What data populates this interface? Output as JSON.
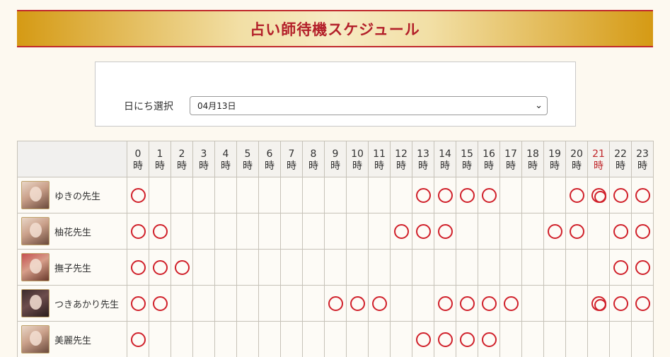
{
  "header": {
    "title": "占い師待機スケジュール"
  },
  "date_selector": {
    "label": "日にち選択",
    "selected": "04月13日"
  },
  "hour_suffix": "時",
  "hours": [
    "0",
    "1",
    "2",
    "3",
    "4",
    "5",
    "6",
    "7",
    "8",
    "9",
    "10",
    "11",
    "12",
    "13",
    "14",
    "15",
    "16",
    "17",
    "18",
    "19",
    "20",
    "21",
    "22",
    "23"
  ],
  "highlight_hour": "21",
  "colors": {
    "accent": "#c0282c",
    "gold": "#d59a14",
    "mark": "#d0202a"
  },
  "legend_marks": {
    "ok": "○",
    "best": "◎"
  },
  "fortune_tellers": [
    {
      "name": "ゆきの先生",
      "avatar": "portrait",
      "slots": [
        "ok",
        "",
        "",
        "",
        "",
        "",
        "",
        "",
        "",
        "",
        "",
        "",
        "",
        "ok",
        "ok",
        "ok",
        "ok",
        "",
        "",
        "",
        "ok",
        "best",
        "ok",
        "ok"
      ]
    },
    {
      "name": "柚花先生",
      "avatar": "portrait",
      "slots": [
        "ok",
        "ok",
        "",
        "",
        "",
        "",
        "",
        "",
        "",
        "",
        "",
        "",
        "ok",
        "ok",
        "ok",
        "",
        "",
        "",
        "",
        "ok",
        "ok",
        "",
        "ok",
        "ok"
      ]
    },
    {
      "name": "撫子先生",
      "avatar": "portrait-warm",
      "slots": [
        "ok",
        "ok",
        "ok",
        "",
        "",
        "",
        "",
        "",
        "",
        "",
        "",
        "",
        "",
        "",
        "",
        "",
        "",
        "",
        "",
        "",
        "",
        "",
        "ok",
        "ok"
      ]
    },
    {
      "name": "つきあかり先生",
      "avatar": "portrait-dark",
      "slots": [
        "ok",
        "ok",
        "",
        "",
        "",
        "",
        "",
        "",
        "",
        "ok",
        "ok",
        "ok",
        "",
        "",
        "ok",
        "ok",
        "ok",
        "ok",
        "",
        "",
        "",
        "best",
        "ok",
        "ok"
      ]
    },
    {
      "name": "美麗先生",
      "avatar": "portrait",
      "slots": [
        "ok",
        "",
        "",
        "",
        "",
        "",
        "",
        "",
        "",
        "",
        "",
        "",
        "",
        "ok",
        "ok",
        "ok",
        "ok",
        "",
        "",
        "",
        "",
        "",
        "",
        ""
      ]
    }
  ]
}
